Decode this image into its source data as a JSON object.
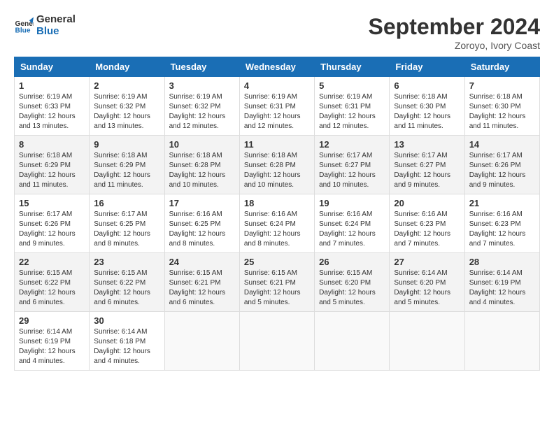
{
  "logo": {
    "line1": "General",
    "line2": "Blue"
  },
  "title": "September 2024",
  "location": "Zoroyo, Ivory Coast",
  "headers": [
    "Sunday",
    "Monday",
    "Tuesday",
    "Wednesday",
    "Thursday",
    "Friday",
    "Saturday"
  ],
  "weeks": [
    [
      {
        "day": "1",
        "sunrise": "6:19 AM",
        "sunset": "6:33 PM",
        "daylight": "12 hours and 13 minutes."
      },
      {
        "day": "2",
        "sunrise": "6:19 AM",
        "sunset": "6:32 PM",
        "daylight": "12 hours and 13 minutes."
      },
      {
        "day": "3",
        "sunrise": "6:19 AM",
        "sunset": "6:32 PM",
        "daylight": "12 hours and 12 minutes."
      },
      {
        "day": "4",
        "sunrise": "6:19 AM",
        "sunset": "6:31 PM",
        "daylight": "12 hours and 12 minutes."
      },
      {
        "day": "5",
        "sunrise": "6:19 AM",
        "sunset": "6:31 PM",
        "daylight": "12 hours and 12 minutes."
      },
      {
        "day": "6",
        "sunrise": "6:18 AM",
        "sunset": "6:30 PM",
        "daylight": "12 hours and 11 minutes."
      },
      {
        "day": "7",
        "sunrise": "6:18 AM",
        "sunset": "6:30 PM",
        "daylight": "12 hours and 11 minutes."
      }
    ],
    [
      {
        "day": "8",
        "sunrise": "6:18 AM",
        "sunset": "6:29 PM",
        "daylight": "12 hours and 11 minutes."
      },
      {
        "day": "9",
        "sunrise": "6:18 AM",
        "sunset": "6:29 PM",
        "daylight": "12 hours and 11 minutes."
      },
      {
        "day": "10",
        "sunrise": "6:18 AM",
        "sunset": "6:28 PM",
        "daylight": "12 hours and 10 minutes."
      },
      {
        "day": "11",
        "sunrise": "6:18 AM",
        "sunset": "6:28 PM",
        "daylight": "12 hours and 10 minutes."
      },
      {
        "day": "12",
        "sunrise": "6:17 AM",
        "sunset": "6:27 PM",
        "daylight": "12 hours and 10 minutes."
      },
      {
        "day": "13",
        "sunrise": "6:17 AM",
        "sunset": "6:27 PM",
        "daylight": "12 hours and 9 minutes."
      },
      {
        "day": "14",
        "sunrise": "6:17 AM",
        "sunset": "6:26 PM",
        "daylight": "12 hours and 9 minutes."
      }
    ],
    [
      {
        "day": "15",
        "sunrise": "6:17 AM",
        "sunset": "6:26 PM",
        "daylight": "12 hours and 9 minutes."
      },
      {
        "day": "16",
        "sunrise": "6:17 AM",
        "sunset": "6:25 PM",
        "daylight": "12 hours and 8 minutes."
      },
      {
        "day": "17",
        "sunrise": "6:16 AM",
        "sunset": "6:25 PM",
        "daylight": "12 hours and 8 minutes."
      },
      {
        "day": "18",
        "sunrise": "6:16 AM",
        "sunset": "6:24 PM",
        "daylight": "12 hours and 8 minutes."
      },
      {
        "day": "19",
        "sunrise": "6:16 AM",
        "sunset": "6:24 PM",
        "daylight": "12 hours and 7 minutes."
      },
      {
        "day": "20",
        "sunrise": "6:16 AM",
        "sunset": "6:23 PM",
        "daylight": "12 hours and 7 minutes."
      },
      {
        "day": "21",
        "sunrise": "6:16 AM",
        "sunset": "6:23 PM",
        "daylight": "12 hours and 7 minutes."
      }
    ],
    [
      {
        "day": "22",
        "sunrise": "6:15 AM",
        "sunset": "6:22 PM",
        "daylight": "12 hours and 6 minutes."
      },
      {
        "day": "23",
        "sunrise": "6:15 AM",
        "sunset": "6:22 PM",
        "daylight": "12 hours and 6 minutes."
      },
      {
        "day": "24",
        "sunrise": "6:15 AM",
        "sunset": "6:21 PM",
        "daylight": "12 hours and 6 minutes."
      },
      {
        "day": "25",
        "sunrise": "6:15 AM",
        "sunset": "6:21 PM",
        "daylight": "12 hours and 5 minutes."
      },
      {
        "day": "26",
        "sunrise": "6:15 AM",
        "sunset": "6:20 PM",
        "daylight": "12 hours and 5 minutes."
      },
      {
        "day": "27",
        "sunrise": "6:14 AM",
        "sunset": "6:20 PM",
        "daylight": "12 hours and 5 minutes."
      },
      {
        "day": "28",
        "sunrise": "6:14 AM",
        "sunset": "6:19 PM",
        "daylight": "12 hours and 4 minutes."
      }
    ],
    [
      {
        "day": "29",
        "sunrise": "6:14 AM",
        "sunset": "6:19 PM",
        "daylight": "12 hours and 4 minutes."
      },
      {
        "day": "30",
        "sunrise": "6:14 AM",
        "sunset": "6:18 PM",
        "daylight": "12 hours and 4 minutes."
      },
      null,
      null,
      null,
      null,
      null
    ]
  ]
}
